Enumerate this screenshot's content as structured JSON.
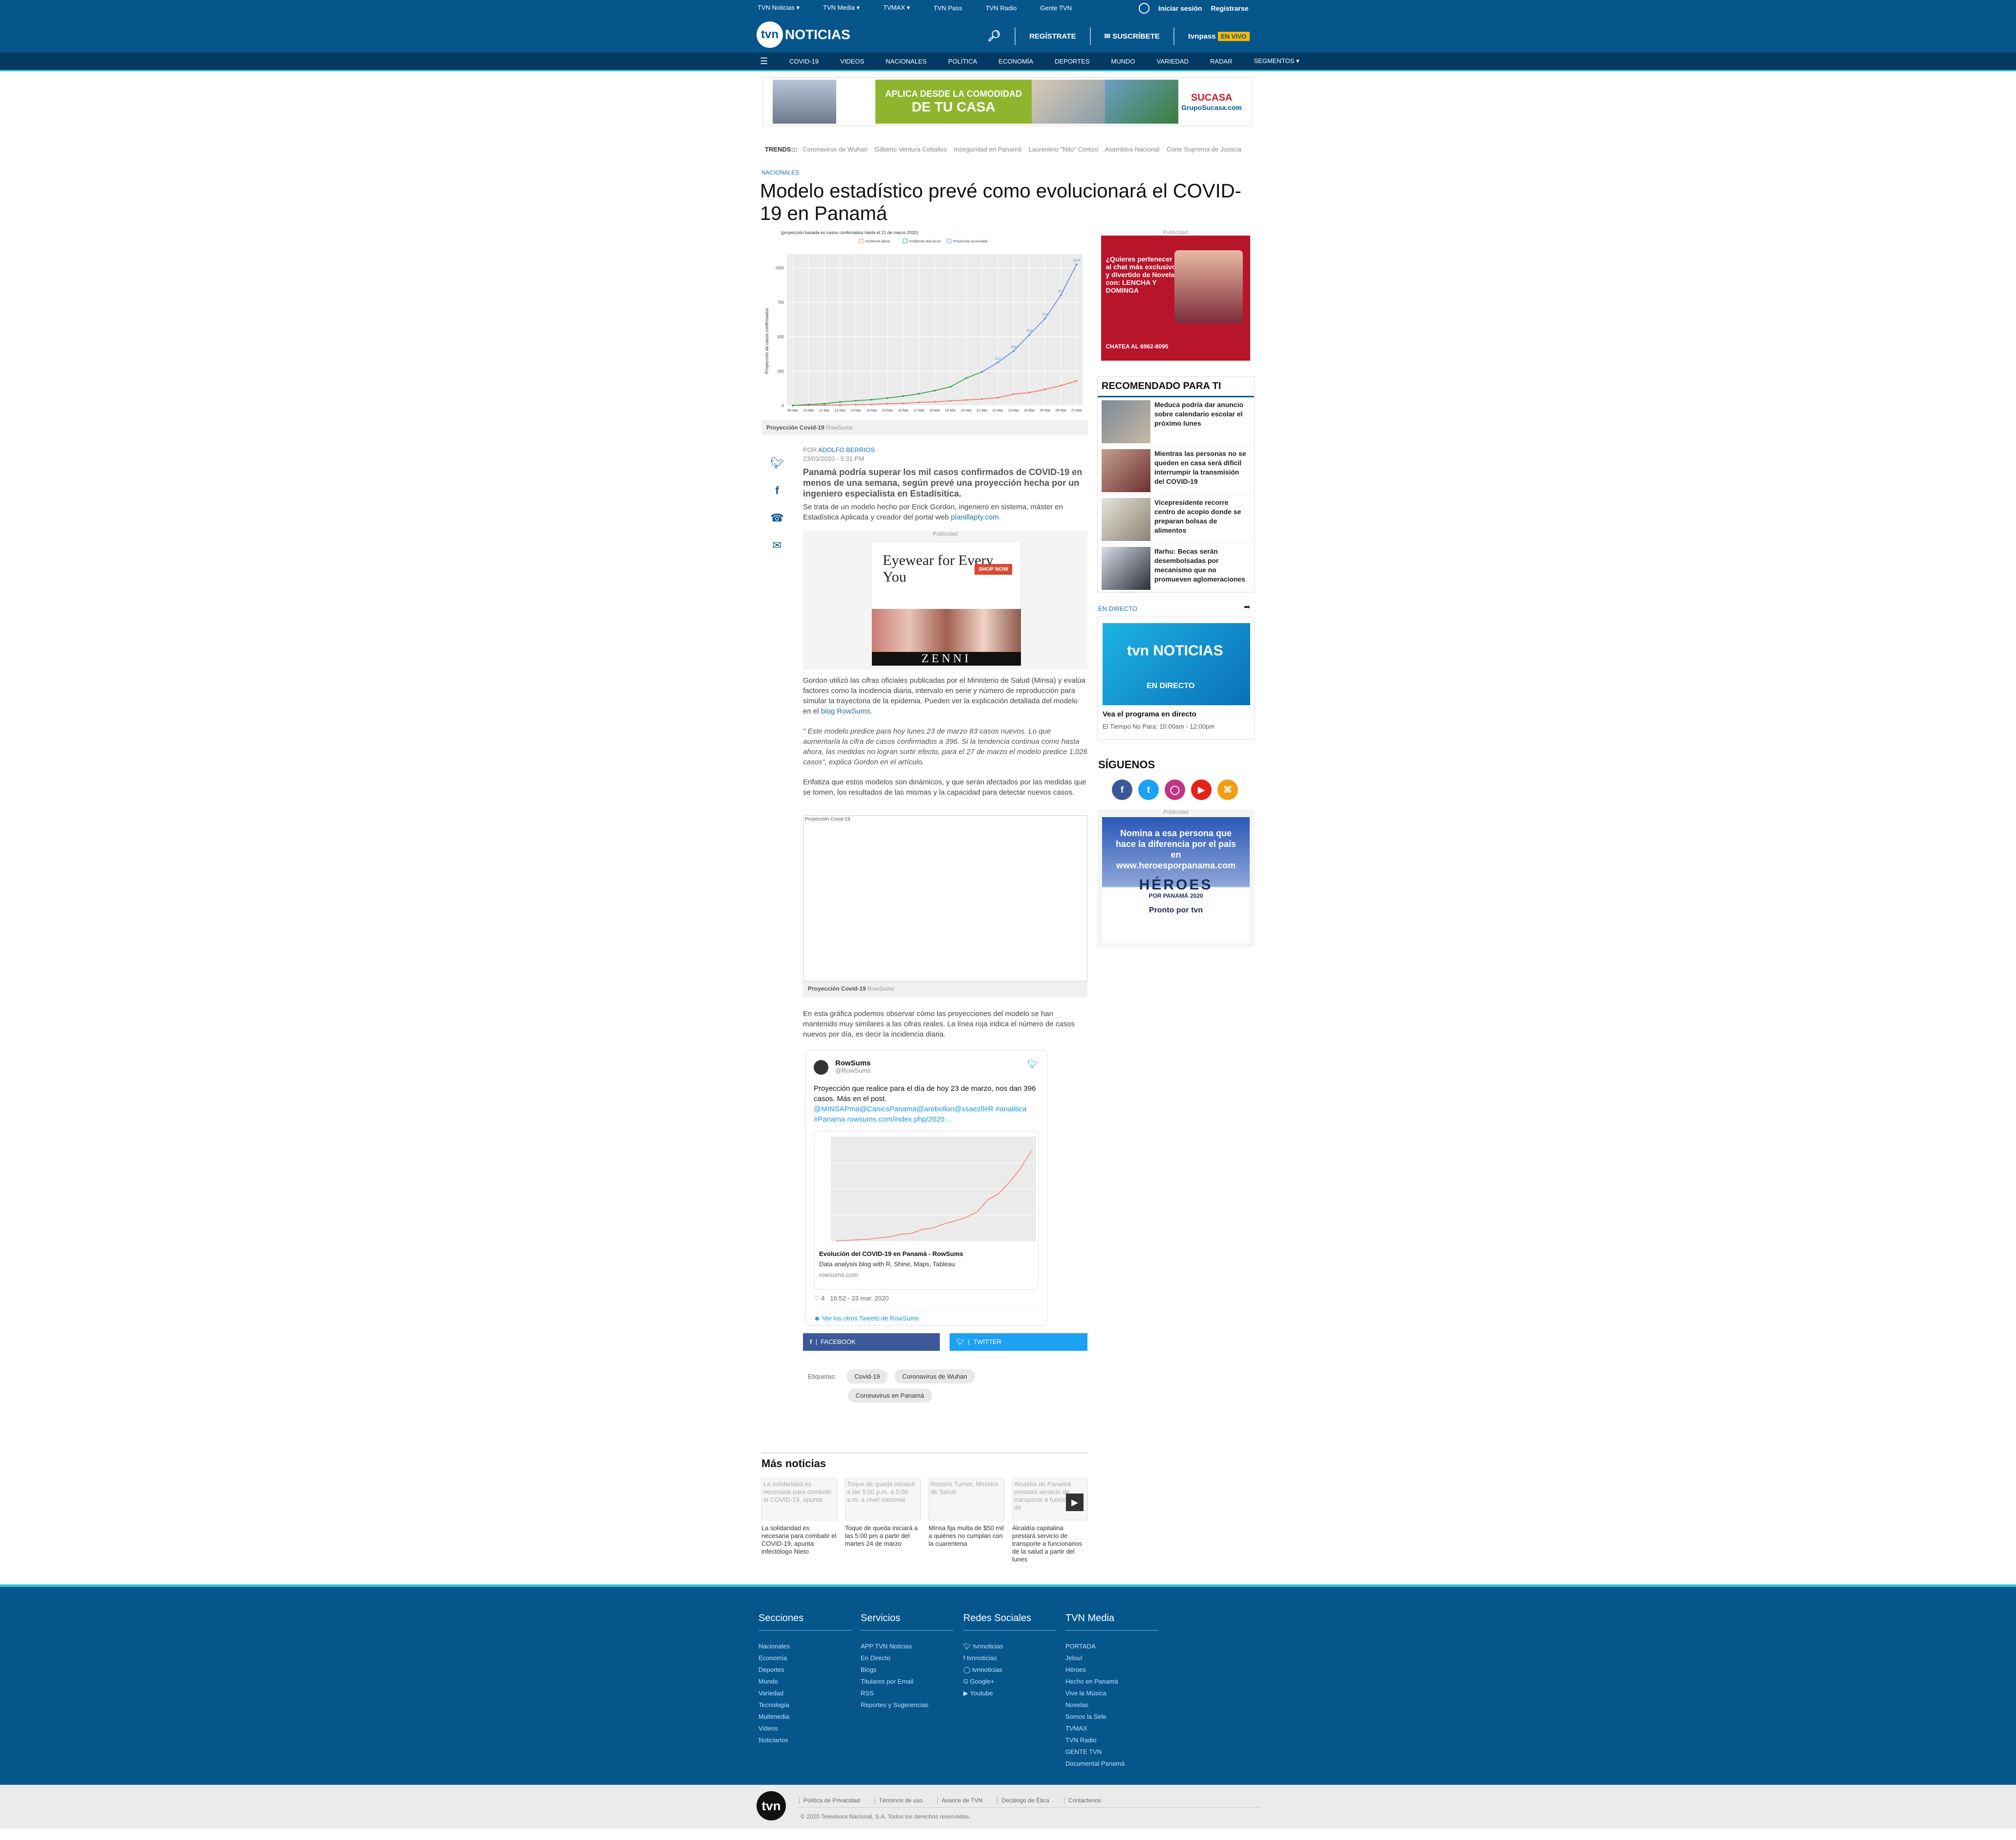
{
  "topnav": [
    "TVN Noticias ▾",
    "TVN Media ▾",
    "TVMAX ▾",
    "TVN Pass",
    "TVN Radio",
    "Gente TVN"
  ],
  "account": {
    "login": "Iniciar sesión",
    "register": "Registrarse"
  },
  "brand": {
    "logo": "tvn",
    "name": "NOTICIAS"
  },
  "header": {
    "register_btn": "REGÍSTRATE",
    "subscribe_btn": "SUSCRÍBETE",
    "pass_label": "tvnpass",
    "live_badge": "EN VIVO"
  },
  "mainnav": [
    "COVID-19",
    "VIDEOS",
    "NACIONALES",
    "POLÍTICA",
    "ECONOMÍA",
    "DEPORTES",
    "MUNDO",
    "VARIEDAD",
    "RADAR",
    "SEGMENTOS ▾"
  ],
  "top_ad": {
    "line1": "APLICA DESDE LA COMODIDAD",
    "line2": "DE TU CASA",
    "brand": "SUCASA",
    "site": "GrupoSucasa.com"
  },
  "trends": {
    "label": "TRENDS:::",
    "items": [
      "Coronavirus de Wuhan",
      "Gilberto Ventura Ceballos",
      "Inseguridad en Panamá",
      "Laurentino \"Nito\" Cortizo",
      "Asamblea Nacional",
      "Corte Suprema de Justicia"
    ]
  },
  "article": {
    "section": "NACIONALES",
    "title": "Modelo estadístico prevé como evolucionará el COVID-19 en Panamá",
    "chart_caption_title": "Proyección Covid-19",
    "chart_caption_source": "RowSums",
    "byline_prefix": "POR",
    "author": "ADOLFO BERRIOS",
    "date": "23/03/2020 - 5:31 PM",
    "lead": "Panamá podría superar los mil casos confirmados de COVID-19 en menos de una semana, según prevé una proyección hecha por un ingeniero especialista en Estadísitica.",
    "p1": "Se trata de un modelo hecho por Erick Gordon, ingeniero en sistema, máster en Estadística Aplicada y creador del portal web",
    "p1_link": "planillapty.com.",
    "ad_label": "Publicidad",
    "ad_title": "Eyewear for Every You",
    "ad_cta": "SHOP NOW",
    "ad_brand": "ZENNI",
    "p2": "Gordon utilizó las cifras oficiales publicadas por el Ministerio de Salud (Minsa) y evalúa factores como la incidencia diaria, intervalo en serie y número de reproducción para simular la trayectoria de la epidemia. Pueden ver la explicación detallada del modelo en el",
    "p2_link": "blog RowSums.",
    "p3": "\" Este modelo predice para hoy lunes 23 de marzo 83 casos nuevos. Lo que aumentaría la cifra de casos confirmados a 396. Si la tendencia continua como hasta ahora, las medidas no logran surtir efecto, para el 27 de marzo el modelo predice 1,026 casos\", explica Gordon en el artículo.",
    "p4": "Enfatiza que estos modelos son dinámicos, y que serán afectados por las medidas que se tomen, los resultados de las mismas y la capacidad para detectar nuevos casos.",
    "embed_label": "Proyección Covid-19",
    "embed_caption_title": "Proyección Covid-19",
    "embed_caption_source": "RowSums",
    "p5": "En esta gráfica podemos observar cómo las proyecciones del modelo se han mantenido muy similares a las cifras reales. La línea roja indica el número de casos nuevos por día, es decir la incidencia diaria.",
    "share_fb": "FACEBOOK",
    "share_tw": "TWITTER",
    "tags_label": "Etiquetas:",
    "tags": [
      "Covid-19",
      "Coronavirus de Wuhan",
      "Coronavirus en Panamá"
    ]
  },
  "tweet": {
    "name": "RowSums",
    "handle": "@RowSums",
    "text": "Proyección que realice para el día de hoy 23 de marzo, nos dan 396 casos. Más en el post.",
    "mentions": "@MINSAPma@CanicsPanama@arebollon@xsaezll#R #analitica #Panama rowsums.com/index.php/2020…",
    "card_title": "Evolución del COVID-19 en Panamá - RowSums",
    "card_desc": "Data analysis blog with R, Shine, Maps, Tableau",
    "card_url": "rowsums.com",
    "likes": "4",
    "time": "16:52 - 23 mar. 2020",
    "more": "Ver los otros Tweets de RowSums"
  },
  "main_chart": {
    "subtitle": "(proyección basada en casos confirmados hasta el 21 de marzo 2020)",
    "legend": [
      "Incidencia diaria",
      "Incidencia real lacum",
      "Proyección acumulada"
    ],
    "ylabel": "Proyección de casos confirmados",
    "yticks": [
      "1000",
      "750",
      "500",
      "250",
      "0"
    ],
    "xticks": [
      "09-Mar",
      "10-Mar",
      "11-Mar",
      "12-Mar",
      "13-Mar",
      "14-Mar",
      "15-Mar",
      "16-Mar",
      "17-Mar",
      "18-Mar",
      "19-Mar",
      "20-Mar",
      "21-Mar",
      "22-Mar",
      "23-Mar",
      "24-Mar",
      "25-Mar",
      "26-Mar",
      "27-Mar"
    ]
  },
  "chart_data": {
    "type": "line",
    "x": [
      "09-Mar",
      "10-Mar",
      "11-Mar",
      "12-Mar",
      "13-Mar",
      "14-Mar",
      "15-Mar",
      "16-Mar",
      "17-Mar",
      "18-Mar",
      "19-Mar",
      "20-Mar",
      "21-Mar",
      "22-Mar",
      "23-Mar",
      "24-Mar",
      "25-Mar",
      "26-Mar",
      "27-Mar"
    ],
    "ylim": [
      0,
      1100
    ],
    "ylabel": "Proyección de casos confirmados",
    "series": [
      {
        "name": "Incidencia diaria",
        "color": "#f07b72",
        "values": [
          1,
          2,
          3,
          4,
          7,
          9,
          14,
          16,
          24,
          27,
          35,
          41,
          48,
          58,
          83,
          95,
          118,
          145,
          180
        ]
      },
      {
        "name": "Incidencia real lacum",
        "color": "#3aa655",
        "values": [
          1,
          8,
          14,
          27,
          36,
          43,
          55,
          69,
          86,
          109,
          137,
          200,
          245,
          null,
          null,
          null,
          null,
          null,
          null
        ]
      },
      {
        "name": "Proyección acumulada",
        "color": "#6b8fe0",
        "values": [
          null,
          null,
          null,
          null,
          null,
          null,
          null,
          null,
          null,
          null,
          null,
          null,
          245,
          313,
          396,
          515,
          633,
          803,
          1026
        ]
      }
    ],
    "point_labels": [
      "313",
      "396",
      "515",
      "633",
      "803",
      "1026"
    ]
  },
  "sidebar": {
    "ad_label": "Publicidad",
    "ad1_text": "¿Quieres pertenecer al chat más exclusivo y divertido de Novelas con: LENCHA Y DOMINGA",
    "ad1_phone": "CHATEA AL 6962-8095",
    "recommended_title": "RECOMENDADO PARA TI",
    "recommended": [
      "Meduca podría dar anuncio sobre calendario escolar el próximo lunes",
      "Mientras las personas no se queden en casa será difícil interrumpir la transmisión del COVID-19",
      "Vicepresidente recorre centro de acopio donde se preparan bolsas de alimentos",
      "Ifarhu: Becas serán desembolsadas por mecanismo que no promueven aglomeraciones"
    ],
    "live_label": "EN DIRECTO",
    "live_logo": "tvn NOTICIAS",
    "live_badge": "EN DIRECTO",
    "live_program": "Vea el programa en directo",
    "live_time": "El Tiempo No Para: 10:00am - 12:00pm",
    "follow_title": "SÍGUENOS",
    "ad2_text": "Nomina a esa persona que hace la diferencia por el país en www.heroesporpanama.com",
    "ad2_brand": "HÉROES",
    "ad2_year": "POR PANAMÁ 2020",
    "ad2_soon": "Pronto por tvn"
  },
  "more_news": {
    "title": "Más noticias",
    "items": [
      {
        "thumb": "La solidaridad es necesaria para combatir el COVID-19, apunta",
        "caption": "La solidaridad es necesaria para combatir el COVID-19, apunta infectólogo Nieto"
      },
      {
        "thumb": "Toque de queda iniciará a las 5:00 p.m. a 5:00 a.m. a nivel nacional",
        "caption": "Toque de queda iniciará a las 5:00 pm a partir del martes 24 de marzo"
      },
      {
        "thumb": "Rosario Turner, Ministra de Salud",
        "caption": "Minsa fija multa de $50 mil a quiénes no cumplan con la cuarentena"
      },
      {
        "thumb": "Alcaldía de Panamá prestará servicio de transporte a funcionarios de",
        "caption": "Alcaldía capitalina prestará servicio de transporte a funcionarios de la salud a partir del lunes"
      }
    ]
  },
  "footer": {
    "cols": [
      {
        "title": "Secciones",
        "items": [
          "Nacionales",
          "Economía",
          "Deportes",
          "Mundo",
          "Variedad",
          "Tecnología",
          "Multimedia",
          "Videos",
          "Noticiarios"
        ]
      },
      {
        "title": "Servicios",
        "items": [
          "APP TVN Noticias",
          "En Directo",
          "Blogs",
          "Titulares por Email",
          "RSS",
          "Reportes y Sugerencias"
        ]
      },
      {
        "title": "Redes Sociales",
        "items": [
          "tvnnoticias",
          "tvnnoticias",
          "tvnnoticias",
          "Google+",
          "Youtube"
        ]
      },
      {
        "title": "TVN Media",
        "items": [
          "PORTADA",
          "Jelou!",
          "Héroes",
          "Hecho en Panamá",
          "Vive la Música",
          "Novelas",
          "Somos la Sele",
          "TVMAX",
          "TVN Radio",
          "GENTE TVN",
          "Documental Panamá"
        ]
      }
    ],
    "links": [
      "Política de Privacidad",
      "Términos de uso",
      "Avance de TVN",
      "Decálogo de Ética",
      "Contáctenos"
    ],
    "copyright": "© 2020 Televisora Nacional, S.A. Todos los derechos reservados."
  },
  "colors": {
    "brand": "#06568c",
    "nav": "#033a63",
    "accent": "#2fc4d6",
    "link": "#1a6fb3"
  }
}
